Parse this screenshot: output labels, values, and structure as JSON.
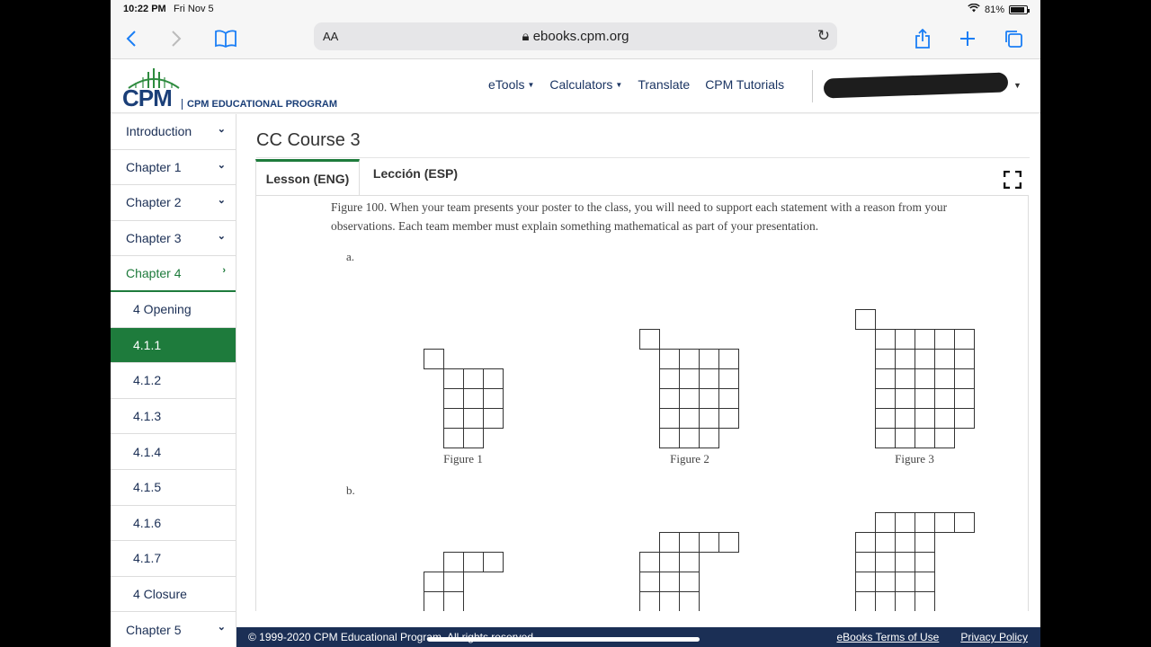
{
  "status_bar": {
    "time": "10:22 PM",
    "date": "Fri Nov 5",
    "battery": "81%"
  },
  "browser": {
    "text_size_label": "AA",
    "url": "ebooks.cpm.org"
  },
  "header": {
    "logo_text": "CPM",
    "logo_subtitle": "CPM EDUCATIONAL PROGRAM",
    "nav": [
      {
        "label": "eTools",
        "dropdown": true
      },
      {
        "label": "Calculators",
        "dropdown": true
      },
      {
        "label": "Translate",
        "dropdown": false
      },
      {
        "label": "CPM Tutorials",
        "dropdown": false
      }
    ]
  },
  "sidebar": {
    "items": [
      {
        "label": "Introduction"
      },
      {
        "label": "Chapter 1"
      },
      {
        "label": "Chapter 2"
      },
      {
        "label": "Chapter 3"
      },
      {
        "label": "Chapter 4"
      },
      {
        "label": "4 Opening"
      },
      {
        "label": "4.1.1"
      },
      {
        "label": "4.1.2"
      },
      {
        "label": "4.1.3"
      },
      {
        "label": "4.1.4"
      },
      {
        "label": "4.1.5"
      },
      {
        "label": "4.1.6"
      },
      {
        "label": "4.1.7"
      },
      {
        "label": "4 Closure"
      },
      {
        "label": "Chapter 5"
      }
    ]
  },
  "main": {
    "course_title": "CC Course 3",
    "tabs": [
      {
        "label": "Lesson (ENG)"
      },
      {
        "label": "Lección (ESP)"
      }
    ],
    "lesson": {
      "paragraph": "Figure 100.  When your team presents your poster to the class, you will need to support each statement with a reason from your observations.  Each team member must explain something mathematical as part of your presentation.",
      "part_a": "a.",
      "part_b": "b.",
      "figure_captions": [
        "Figure 1",
        "Figure 2",
        "Figure 3"
      ]
    }
  },
  "footer": {
    "copyright": "© 1999-2020 CPM Educational Program. All rights reserved.",
    "links": [
      "eBooks Terms of Use",
      "Privacy Policy"
    ]
  },
  "colors": {
    "accent_green": "#1e7b3c",
    "navy": "#1b2f55",
    "ios_blue": "#1a7ef5"
  }
}
